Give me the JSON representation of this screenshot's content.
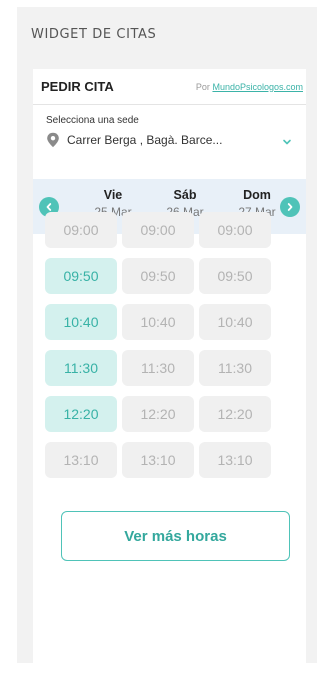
{
  "section": {
    "title": "WIDGET DE CITAS"
  },
  "widget": {
    "title": "PEDIR CITA",
    "by_prefix": "Por",
    "by_link": "MundoPsicologos.com"
  },
  "sede": {
    "label": "Selecciona una sede",
    "value": "Carrer Berga , Bagà. Barce..."
  },
  "days": [
    {
      "name": "Vie",
      "date": "25 Mar"
    },
    {
      "name": "Sáb",
      "date": "26 Mar"
    },
    {
      "name": "Dom",
      "date": "27 Mar"
    }
  ],
  "slots": [
    [
      "09:00",
      "09:00",
      "09:00"
    ],
    [
      "09:50",
      "09:50",
      "09:50"
    ],
    [
      "10:40",
      "10:40",
      "10:40"
    ],
    [
      "11:30",
      "11:30",
      "11:30"
    ],
    [
      "12:20",
      "12:20",
      "12:20"
    ],
    [
      "13:10",
      "13:10",
      "13:10"
    ]
  ],
  "available": [
    [
      false,
      false,
      false
    ],
    [
      true,
      false,
      false
    ],
    [
      true,
      false,
      false
    ],
    [
      true,
      false,
      false
    ],
    [
      true,
      false,
      false
    ],
    [
      false,
      false,
      false
    ]
  ],
  "more_button": "Ver más horas",
  "colors": {
    "accent": "#4fc3b8",
    "available_bg": "#d4f1ee",
    "available_text": "#38b2a6",
    "unavailable_bg": "#f0f0f0",
    "unavailable_text": "#b3b3b3",
    "day_strip_bg": "#e8f0f8"
  },
  "icons": {
    "location": "map-pin-icon",
    "dropdown": "chevron-down-icon",
    "prev": "chevron-left-icon",
    "next": "chevron-right-icon"
  }
}
